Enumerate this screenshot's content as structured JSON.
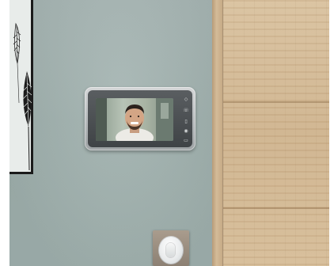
{
  "scene": {
    "description_icons": [
      "leaf-art-icon",
      "intercom-monitor-icon",
      "light-switch-icon"
    ],
    "colors": {
      "wall": "#a2b3b0",
      "wood_door": "#d3b995",
      "frame_black": "#1b1b1b",
      "intercom_silver": "#b8bcbe"
    }
  },
  "intercom": {
    "brand_label": "",
    "controls": [
      {
        "icon": "menu-icon",
        "glyph": "◇"
      },
      {
        "icon": "call-icon",
        "glyph": "☏"
      },
      {
        "icon": "door-open-icon",
        "glyph": "▯"
      },
      {
        "icon": "camera-icon",
        "glyph": "◉"
      },
      {
        "icon": "hang-up-icon",
        "glyph": "▭"
      }
    ]
  }
}
